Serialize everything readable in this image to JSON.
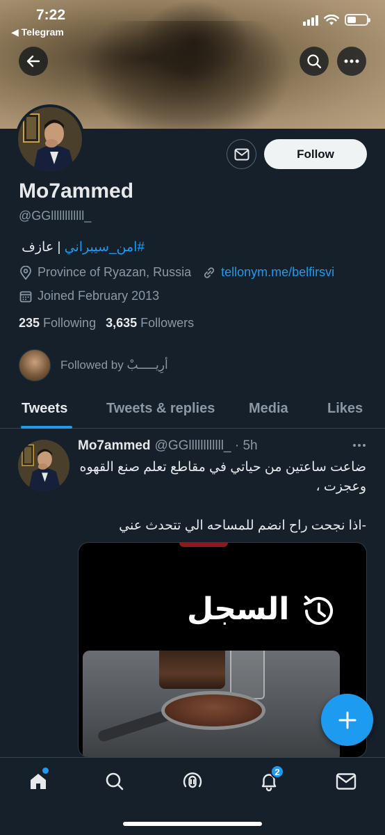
{
  "status_bar": {
    "time": "7:22",
    "back_app": "◀ Telegram"
  },
  "header": {
    "back_icon": "arrow-left-icon",
    "search_icon": "search-icon",
    "more_icon": "more-horizontal-icon"
  },
  "profile": {
    "display_name": "Mo7ammed",
    "handle": "@GGllllllllllll_",
    "bio_tag": "#امن_سيبراني",
    "bio_rest": " | عازف",
    "location": "Province of Ryazan, Russia",
    "website": "tellonym.me/belfirsvi",
    "joined": "Joined February 2013",
    "following_count": "235",
    "following_label": "Following",
    "followers_count": "3,635",
    "followers_label": "Followers",
    "followed_by_text": "Followed by أرِيـــــبْ",
    "follow_label": "Follow"
  },
  "tabs": [
    {
      "label": "Tweets",
      "active": true
    },
    {
      "label": "Tweets & replies",
      "active": false
    },
    {
      "label": "Media",
      "active": false
    },
    {
      "label": "Likes",
      "active": false
    }
  ],
  "tweet": {
    "name": "Mo7ammed",
    "handle_time": "@GGllllllllllll_ · 5h",
    "text": "ضاعت ساعتين من حياتي في مقاطع تعلم صنع القهوه وعجزت ،\n\n-اذا نجحت راح انضم للمساحه الي تتحدث عني",
    "media_label": "السجل"
  },
  "bottom_nav": {
    "items": [
      "home-icon",
      "search-icon",
      "spaces-icon",
      "notifications-icon",
      "messages-icon"
    ],
    "notifications_badge": "2"
  },
  "colors": {
    "background": "#15202b",
    "accent": "#1d9bf0",
    "text_primary": "#e7e9ea",
    "text_secondary": "#8b98a5"
  }
}
